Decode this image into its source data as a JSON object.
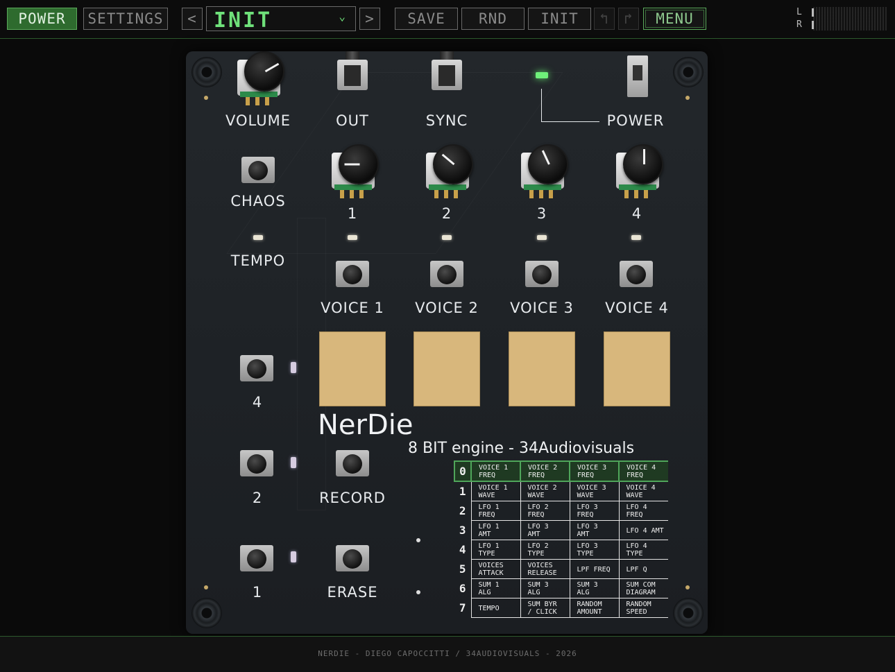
{
  "toolbar": {
    "power_label": "POWER",
    "settings_label": "SETTINGS",
    "prev_label": "<",
    "preset_name": "INIT",
    "preset_caret": "⌄",
    "next_label": ">",
    "save_label": "SAVE",
    "rnd_label": "RND",
    "init_label": "INIT",
    "undo_icon": "undo-icon",
    "redo_icon": "redo-icon",
    "menu_label": "MENU",
    "meter_labels": [
      "L",
      "R"
    ]
  },
  "board": {
    "volume": "VOLUME",
    "out": "OUT",
    "sync": "SYNC",
    "power": "POWER",
    "chaos": "CHAOS",
    "tempo": "TEMPO",
    "knob_labels": [
      "1",
      "2",
      "3",
      "4"
    ],
    "voice_labels": [
      "VOICE 1",
      "VOICE 2",
      "VOICE 3",
      "VOICE 4"
    ],
    "side_button_labels": [
      "4",
      "2",
      "1"
    ],
    "record": "RECORD",
    "erase": "ERASE",
    "brand": "NerDie",
    "tagline": "8 BIT engine - 34Audiovisuals"
  },
  "matrix": {
    "rows": [
      {
        "idx": "0",
        "cells": [
          "VOICE 1 FREQ",
          "VOICE 2 FREQ",
          "VOICE 3 FREQ",
          "VOICE 4 FREQ"
        ]
      },
      {
        "idx": "1",
        "cells": [
          "VOICE 1 WAVE",
          "VOICE 2 WAVE",
          "VOICE 3 WAVE",
          "VOICE 4 WAVE"
        ]
      },
      {
        "idx": "2",
        "cells": [
          "LFO 1 FREQ",
          "LFO 2 FREQ",
          "LFO 3 FREQ",
          "LFO 4 FREQ"
        ]
      },
      {
        "idx": "3",
        "cells": [
          "LFO 1 AMT",
          "LFO 3 AMT",
          "LFO 3 AMT",
          "LFO 4 AMT"
        ]
      },
      {
        "idx": "4",
        "cells": [
          "LFO 1 TYPE",
          "LFO 2 TYPE",
          "LFO 3 TYPE",
          "LFO 4 TYPE"
        ]
      },
      {
        "idx": "5",
        "cells": [
          "VOICES ATTACK",
          "VOICES RELEASE",
          "LPF FREQ",
          "LPF Q"
        ]
      },
      {
        "idx": "6",
        "cells": [
          "SUM 1 ALG",
          "SUM 3 ALG",
          "SUM 3 ALG",
          "SUM COM DIAGRAM"
        ]
      },
      {
        "idx": "7",
        "cells": [
          "TEMPO",
          "SUM BYR / CLICK",
          "RANDOM AMOUNT",
          "RANDOM SPEED"
        ]
      }
    ]
  },
  "footer": {
    "credit": "NERDIE - DIEGO CAPOCCITTI / 34AUDIOVISUALS - 2026"
  },
  "colors": {
    "accent": "#6fe07a",
    "active_button": "#2e6b2e",
    "board": "#1f2327",
    "pad": "#d8b77c"
  }
}
